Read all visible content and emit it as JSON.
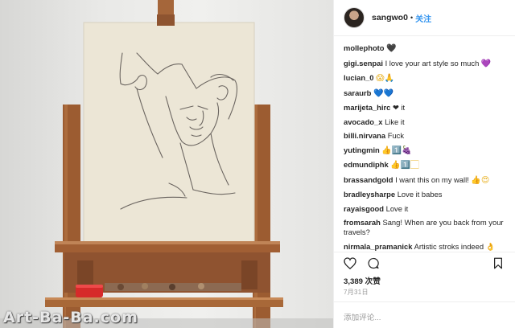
{
  "post": {
    "username": "sangwo0",
    "separator": "•",
    "follow_label": "关注"
  },
  "comments": [
    {
      "user": "mollephoto",
      "text": "",
      "emoji": "🖤",
      "emoji_color": "#111111"
    },
    {
      "user": "gigi.senpai",
      "text": "I love your art style so much",
      "emoji": "💜",
      "emoji_color": "#a34fd8"
    },
    {
      "user": "lucian_0",
      "text": "",
      "emoji": "😱🙏",
      "emoji_color": "#e8b020"
    },
    {
      "user": "saraurb",
      "text": "",
      "emoji": "💙💙",
      "emoji_color": "#2f7de1"
    },
    {
      "user": "marijeta_hirc",
      "text": "❤ it",
      "emoji": "",
      "emoji_color": ""
    },
    {
      "user": "avocado_x",
      "text": "Like it",
      "emoji": "",
      "emoji_color": ""
    },
    {
      "user": "billi.nirvana",
      "text": "Fuck",
      "emoji": "",
      "emoji_color": ""
    },
    {
      "user": "yutingmin",
      "text": "",
      "emoji": "👍1️⃣🍇",
      "emoji_color": "#e8b020"
    },
    {
      "user": "edmundiphk",
      "text": "",
      "emoji": "👍1️⃣🏻",
      "emoji_color": "#e8b020"
    },
    {
      "user": "brassandgold",
      "text": "I want this on my wall!",
      "emoji": "👍😍",
      "emoji_color": "#e8b020"
    },
    {
      "user": "bradleysharpe",
      "text": "Love it babes",
      "emoji": "",
      "emoji_color": ""
    },
    {
      "user": "rayaisgood",
      "text": "Love it",
      "emoji": "",
      "emoji_color": ""
    },
    {
      "user": "fromsarah",
      "text": "Sang! When are you back from your travels?",
      "emoji": "",
      "emoji_color": ""
    },
    {
      "user": "nirmala_pramanick",
      "text": "Artistic stroks indeed 👌love d continuty👍",
      "emoji": "",
      "emoji_color": ""
    }
  ],
  "actions": {
    "like_icon": "heart-icon",
    "comment_icon": "speech-bubble-icon",
    "save_icon": "bookmark-icon"
  },
  "likes": "3,389 次赞",
  "date": "7月31日",
  "add_comment_placeholder": "添加评论...",
  "watermark": "Art-Ba-Ba.com",
  "colors": {
    "accent": "#3897f0",
    "text": "#262626",
    "muted": "#999999",
    "divider": "#efefef"
  }
}
